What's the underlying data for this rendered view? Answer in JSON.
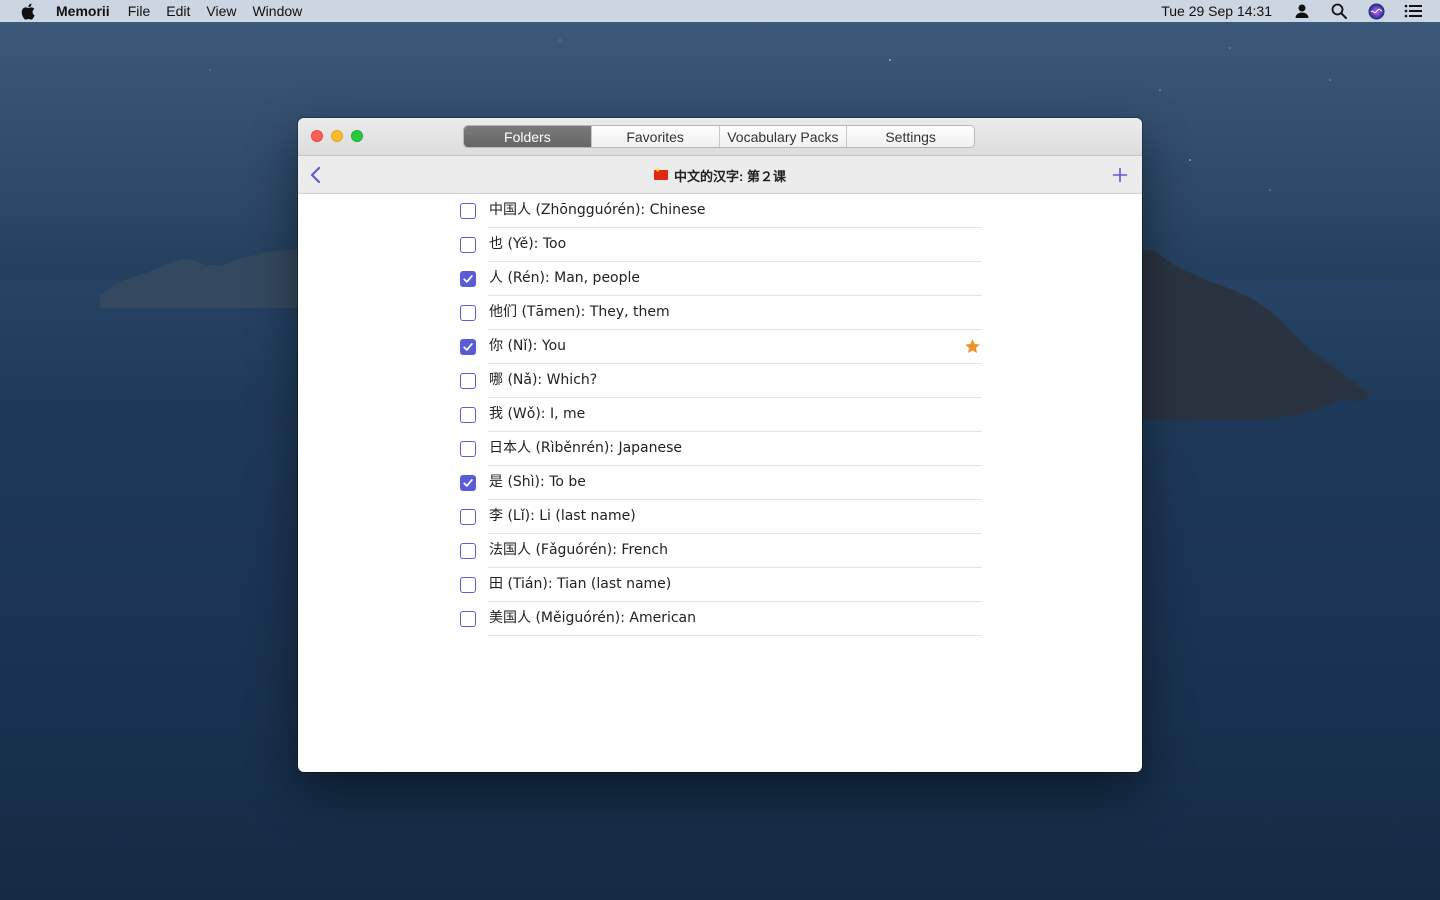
{
  "menubar": {
    "app_name": "Memorii",
    "menus": [
      "File",
      "Edit",
      "View",
      "Window"
    ],
    "clock": "Tue 29 Sep  14:31",
    "icons": [
      "user-icon",
      "spotlight-search-icon",
      "siri-icon",
      "control-center-icon"
    ]
  },
  "window": {
    "tabs": [
      {
        "label": "Folders",
        "active": true
      },
      {
        "label": "Favorites",
        "active": false
      },
      {
        "label": "Vocabulary Packs",
        "active": false
      },
      {
        "label": "Settings",
        "active": false
      }
    ],
    "nav_title": "中文的汉字: 第２课",
    "accent_color": "#5a5cd6",
    "star_color": "#f0922b",
    "items": [
      {
        "label": "中国人 (Zhōngguórén): Chinese",
        "checked": false,
        "favorite": false
      },
      {
        "label": "也 (Yě): Too",
        "checked": false,
        "favorite": false
      },
      {
        "label": "人 (Rén): Man, people",
        "checked": true,
        "favorite": false
      },
      {
        "label": "他们 (Tāmen): They, them",
        "checked": false,
        "favorite": false
      },
      {
        "label": "你 (Nǐ): You",
        "checked": true,
        "favorite": true
      },
      {
        "label": "哪 (Nǎ): Which?",
        "checked": false,
        "favorite": false
      },
      {
        "label": "我 (Wǒ): I, me",
        "checked": false,
        "favorite": false
      },
      {
        "label": "日本人 (Rìběnrén): Japanese",
        "checked": false,
        "favorite": false
      },
      {
        "label": "是 (Shì): To be",
        "checked": true,
        "favorite": false
      },
      {
        "label": "李 (Lǐ): Li (last name)",
        "checked": false,
        "favorite": false
      },
      {
        "label": "法国人 (Fǎguórén): French",
        "checked": false,
        "favorite": false
      },
      {
        "label": "田 (Tián): Tian (last name)",
        "checked": false,
        "favorite": false
      },
      {
        "label": "美国人 (Měiguórén): American",
        "checked": false,
        "favorite": false
      }
    ]
  }
}
